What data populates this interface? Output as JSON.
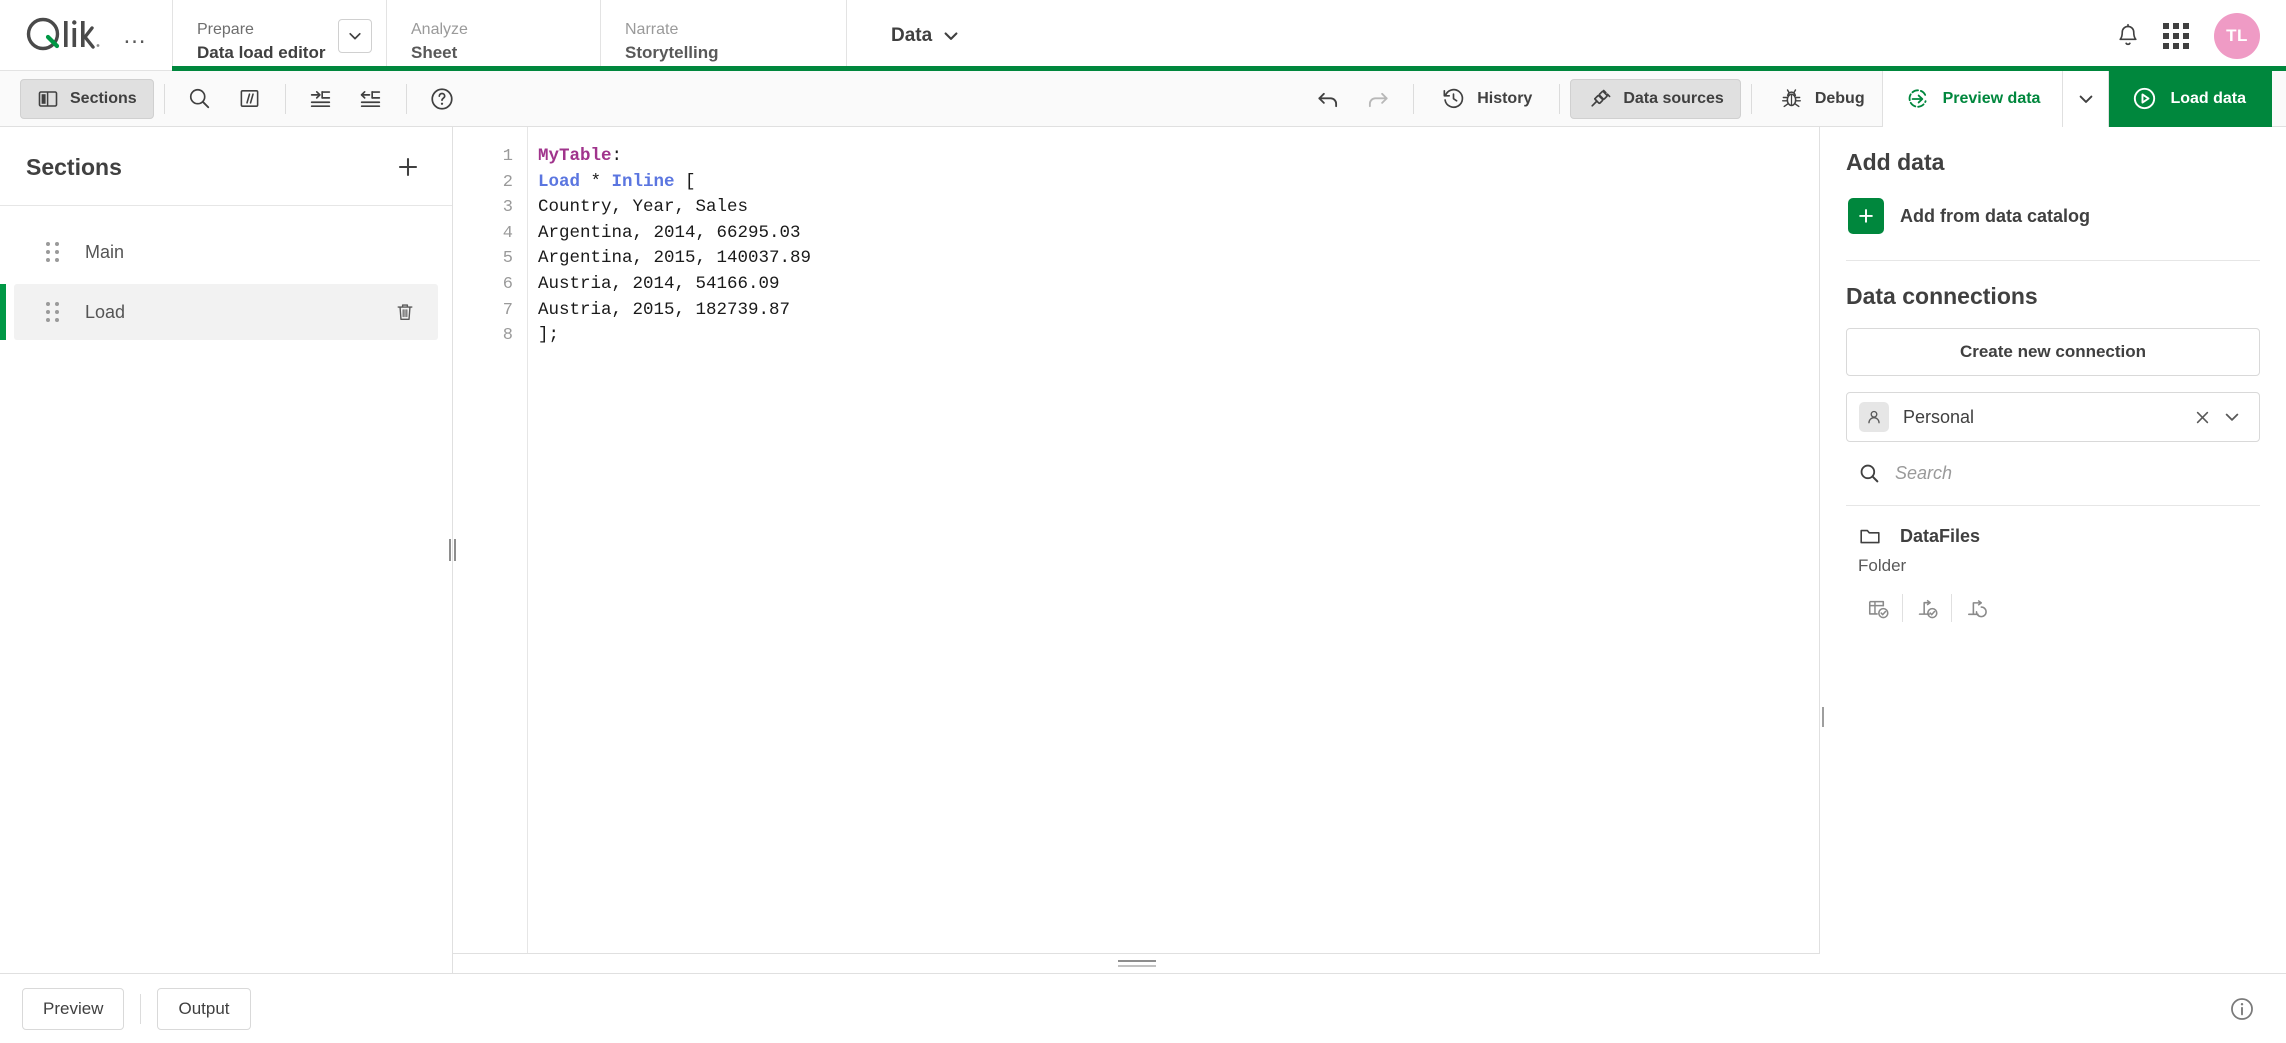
{
  "header": {
    "logo_alt": "Qlik",
    "more_menu": "…",
    "tabs": [
      {
        "id": "prepare",
        "top": "Prepare",
        "bottom": "Data load editor",
        "active": true,
        "has_chevron": true
      },
      {
        "id": "analyze",
        "top": "Analyze",
        "bottom": "Sheet",
        "active": false,
        "has_chevron": false
      },
      {
        "id": "narrate",
        "top": "Narrate",
        "bottom": "Storytelling",
        "active": false,
        "has_chevron": false
      }
    ],
    "data_button": "Data",
    "avatar_initials": "TL",
    "accent_color": "#00873d",
    "avatar_color": "#ef9bc5"
  },
  "toolbar": {
    "sections_label": "Sections",
    "sections_toggled": true,
    "search_icon": "search-icon",
    "comment_label": "//",
    "indent_icon": "indent-increase-icon",
    "outdent_icon": "indent-decrease-icon",
    "help_icon": "help-circle-icon",
    "undo_icon": "undo-icon",
    "redo_icon": "redo-icon",
    "redo_disabled": true,
    "history_label": "History",
    "data_sources_label": "Data sources",
    "data_sources_toggled": true,
    "debug_label": "Debug",
    "preview_data_label": "Preview data",
    "load_data_label": "Load data"
  },
  "sections": {
    "title": "Sections",
    "add_label": "+",
    "items": [
      {
        "label": "Main",
        "selected": false,
        "deletable": false
      },
      {
        "label": "Load",
        "selected": true,
        "deletable": true
      }
    ]
  },
  "editor": {
    "line_numbers": [
      "1",
      "2",
      "3",
      "4",
      "5",
      "6",
      "7",
      "8"
    ],
    "lines": [
      {
        "tokens": [
          {
            "t": "MyTable",
            "c": "tbl"
          },
          {
            "t": ":",
            "c": "pn"
          }
        ]
      },
      {
        "tokens": [
          {
            "t": "Load",
            "c": "kw"
          },
          {
            "t": " * ",
            "c": "pn"
          },
          {
            "t": "Inline",
            "c": "kw"
          },
          {
            "t": " [",
            "c": "pn"
          }
        ]
      },
      {
        "tokens": [
          {
            "t": "Country, Year, Sales",
            "c": "pn"
          }
        ]
      },
      {
        "tokens": [
          {
            "t": "Argentina, 2014, 66295.03",
            "c": "pn"
          }
        ]
      },
      {
        "tokens": [
          {
            "t": "Argentina, 2015, 140037.89",
            "c": "pn"
          }
        ]
      },
      {
        "tokens": [
          {
            "t": "Austria, 2014, 54166.09",
            "c": "pn"
          }
        ]
      },
      {
        "tokens": [
          {
            "t": "Austria, 2015, 182739.87",
            "c": "pn"
          }
        ]
      },
      {
        "tokens": [
          {
            "t": "];",
            "c": "pn"
          }
        ]
      }
    ],
    "plain_text": "MyTable:\nLoad * Inline [\nCountry, Year, Sales\nArgentina, 2014, 66295.03\nArgentina, 2015, 140037.89\nAustria, 2014, 54166.09\nAustria, 2015, 182739.87\n];",
    "colors": {
      "table": "#a0348c",
      "keyword": "#5b76e0",
      "plain": "#1a1a1a"
    }
  },
  "right_panel": {
    "add_data_title": "Add data",
    "add_catalog_label": "Add from data catalog",
    "data_connections_title": "Data connections",
    "create_connection_label": "Create new connection",
    "space_value": "Personal",
    "search_placeholder": "Search",
    "search_value": "",
    "connections": [
      {
        "name": "DataFiles",
        "type": "Folder"
      }
    ],
    "connection_actions": [
      "select-data-icon",
      "insert-script-icon",
      "edit-connection-icon"
    ]
  },
  "footer": {
    "preview_label": "Preview",
    "output_label": "Output",
    "info_icon": "info-circle-icon"
  }
}
